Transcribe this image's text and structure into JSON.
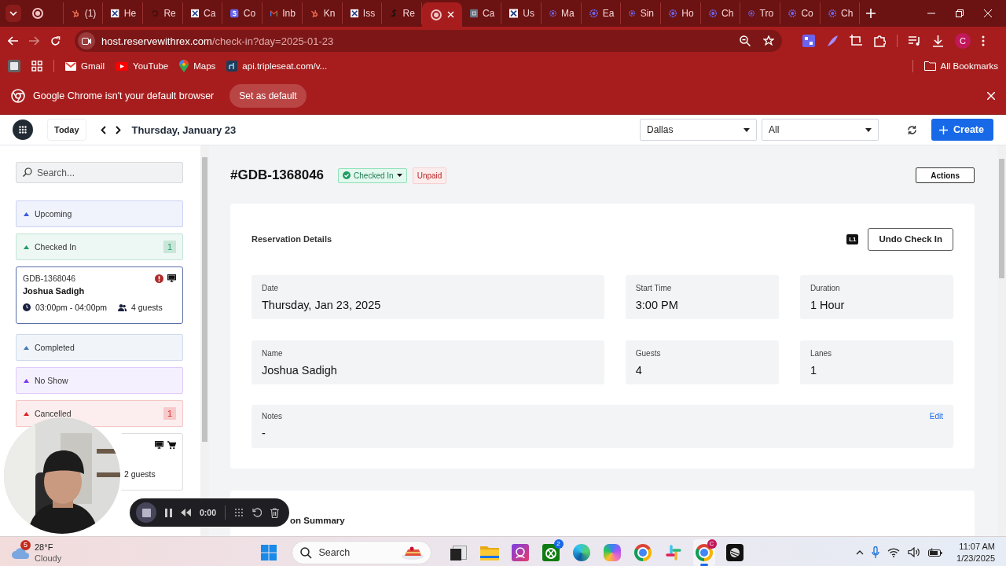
{
  "browser": {
    "tabs": [
      {
        "selected": false
      },
      {
        "title": "(1)",
        "selected": false
      },
      {
        "title": "He",
        "selected": false
      },
      {
        "title": "Re",
        "selected": false
      },
      {
        "title": "Ca",
        "selected": false
      },
      {
        "title": "Co",
        "selected": false
      },
      {
        "title": "Inb",
        "selected": false
      },
      {
        "title": "Kn",
        "selected": false
      },
      {
        "title": "Iss",
        "selected": false
      },
      {
        "title": "Re",
        "selected": false
      },
      {
        "selected": true
      },
      {
        "title": "Ca",
        "selected": false
      },
      {
        "title": "Us",
        "selected": false
      },
      {
        "title": "Ma",
        "selected": false
      },
      {
        "title": "Ea",
        "selected": false
      },
      {
        "title": "Sin",
        "selected": false
      },
      {
        "title": "Ho",
        "selected": false
      },
      {
        "title": "Ch",
        "selected": false
      },
      {
        "title": "Tro",
        "selected": false
      },
      {
        "title": "Co",
        "selected": false
      },
      {
        "title": "Ch",
        "selected": false
      }
    ],
    "forward_disabled": true,
    "address": {
      "host": "host.reservewithrex.com",
      "path": "/check-in?day=2025-01-23"
    },
    "profile": "C",
    "bookmarks": [
      {
        "kind": "gmail",
        "label": "Gmail"
      },
      {
        "kind": "youtube",
        "label": "YouTube"
      },
      {
        "kind": "maps",
        "label": "Maps"
      },
      {
        "kind": "api",
        "label": "api.tripleseat.com/v..."
      }
    ],
    "all_bookmarks": "All Bookmarks",
    "infobar": {
      "message": "Google Chrome isn't your default browser",
      "button": "Set as default"
    }
  },
  "header": {
    "today": "Today",
    "date": "Thursday, January 23",
    "location": "Dallas",
    "filter": "All",
    "create": "Create"
  },
  "sidebar": {
    "search": {
      "placeholder": "Search..."
    },
    "sections": [
      {
        "label": "Upcoming",
        "color": "#3b5bdb"
      },
      {
        "label": "Checked In",
        "color": "#1f9d63",
        "count": "1",
        "reservations": [
          {
            "id": "GDB-1368046",
            "name": "Joshua Sadigh",
            "time": "03:00pm - 04:00pm",
            "guests": "4 guests",
            "selected": true
          }
        ]
      },
      {
        "label": "Completed",
        "color": "#4a78b8"
      },
      {
        "label": "No Show",
        "color": "#7c3aed"
      },
      {
        "label": "Cancelled",
        "color": "#dc2626",
        "count": "1",
        "reservations": [
          {
            "guests": "2 guests",
            "selected": false
          }
        ]
      }
    ]
  },
  "reservation": {
    "number": "#GDB-1368046",
    "status": "Checked In",
    "payment": "Unpaid",
    "actions": "Actions",
    "details": {
      "title": "Reservation Details",
      "level_badge": "L1",
      "undo": "Undo Check In",
      "fields": [
        {
          "label": "Date",
          "value": "Thursday, Jan 23, 2025"
        },
        {
          "label": "Start Time",
          "value": "3:00 PM"
        },
        {
          "label": "Duration",
          "value": "1 Hour"
        },
        {
          "label": "Name",
          "value": "Joshua Sadigh"
        },
        {
          "label": "Guests",
          "value": "4"
        },
        {
          "label": "Lanes",
          "value": "1"
        }
      ],
      "notes": {
        "label": "Notes",
        "value": "-",
        "action": "Edit"
      }
    },
    "summary_title": "on Summary"
  },
  "recorder": {
    "time": "0:00"
  },
  "taskbar": {
    "weather": {
      "badge": "5",
      "temp": "28°F",
      "condition": "Cloudy"
    },
    "search": {
      "placeholder": "Search"
    },
    "apps": [
      {
        "kind": "taskview",
        "selected": false
      },
      {
        "kind": "folder",
        "selected": false
      },
      {
        "kind": "photos",
        "selected": false
      },
      {
        "kind": "xbox",
        "badge": "2",
        "selected": false
      },
      {
        "kind": "edge",
        "selected": false
      },
      {
        "kind": "copilot",
        "selected": false
      },
      {
        "kind": "chrome",
        "selected": false
      },
      {
        "kind": "slack",
        "selected": false
      },
      {
        "kind": "chrome",
        "badge": "C",
        "selected": true
      },
      {
        "kind": "dark",
        "selected": false
      }
    ],
    "time": "11:07 AM",
    "date": "1/23/2025"
  }
}
